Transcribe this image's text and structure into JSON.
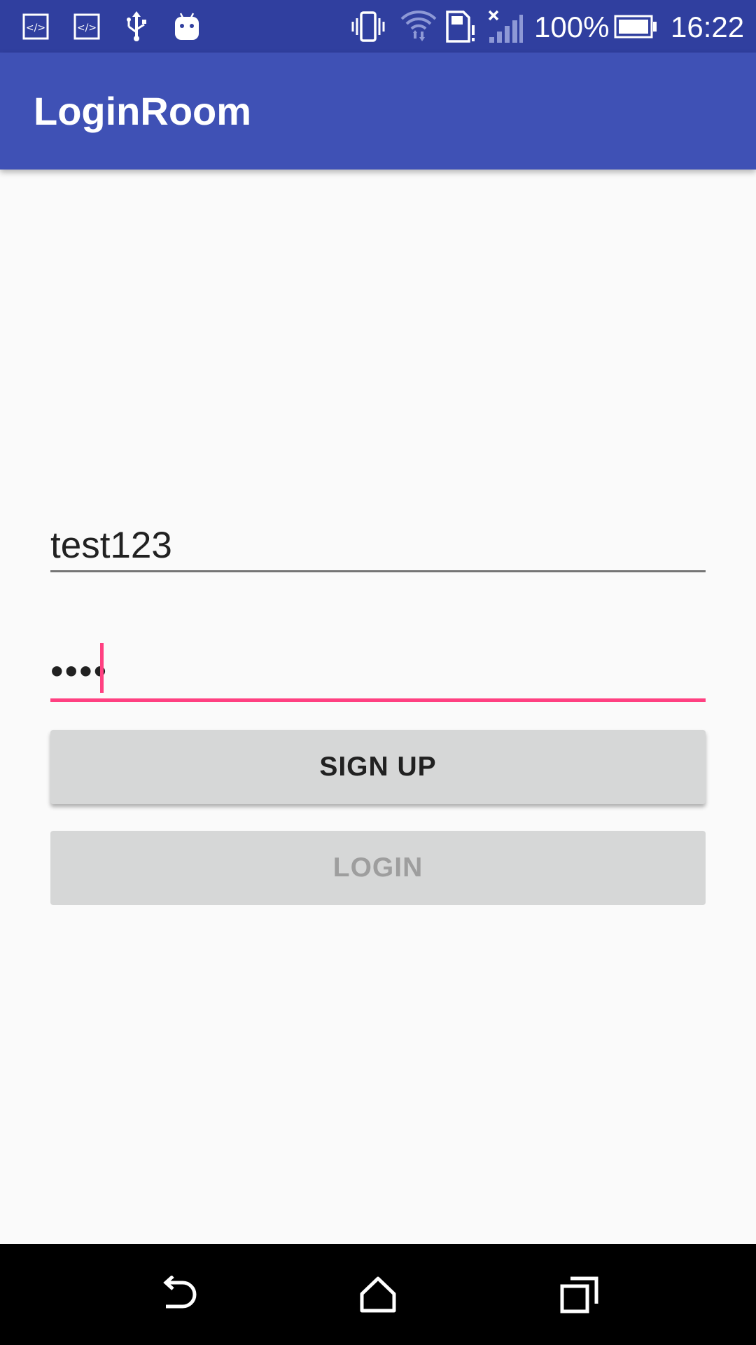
{
  "status_bar": {
    "icons": [
      "code-icon",
      "code-icon",
      "usb-icon",
      "android-icon",
      "vibrate-icon",
      "wifi-icon",
      "sim-card-icon",
      "cell-signal-icon",
      "battery-icon"
    ],
    "battery_text": "100%",
    "time": "16:22"
  },
  "app_bar": {
    "title": "LoginRoom"
  },
  "form": {
    "username_value": "test123",
    "password_value": "••••",
    "signup_label": "SIGN UP",
    "login_label": "LOGIN"
  },
  "colors": {
    "status_bar": "#303F9F",
    "app_bar": "#3F51B5",
    "accent": "#FF4081",
    "background": "#FAFAFA",
    "button": "#D6D7D7"
  },
  "nav_bar": {
    "buttons": [
      "back-icon",
      "home-icon",
      "recents-icon"
    ]
  }
}
